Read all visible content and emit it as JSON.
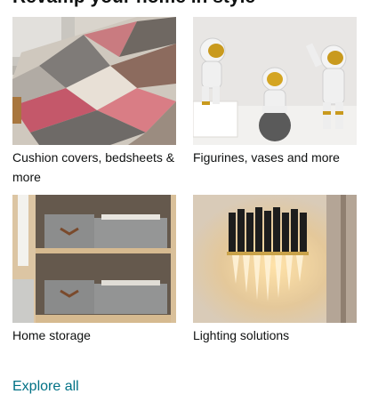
{
  "card": {
    "title": "Revamp your home in style",
    "tiles": [
      {
        "label": "Cushion covers, bedsheets & more",
        "image": "geometric-rug-photo"
      },
      {
        "label": "Figurines, vases and more",
        "image": "astronaut-figurines-photo"
      },
      {
        "label": "Home storage",
        "image": "storage-boxes-shelf-photo"
      },
      {
        "label": "Lighting solutions",
        "image": "crystal-wall-lamp-photo"
      }
    ],
    "explore_label": "Explore all"
  },
  "colors": {
    "link": "#007185",
    "text": "#0f1111"
  }
}
